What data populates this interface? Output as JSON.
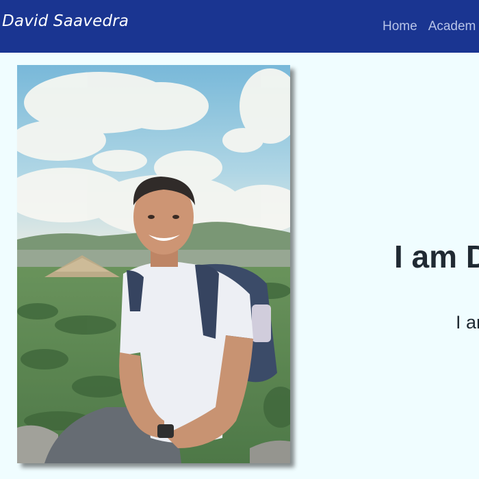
{
  "navbar": {
    "brand": "David Saavedra",
    "links": [
      "Home",
      "Academ"
    ]
  },
  "hero": {
    "heading": "I am D",
    "subtext": "I ar"
  },
  "colors": {
    "navbar_bg": "#1a3591",
    "page_bg": "#f0fdff",
    "heading_text": "#202a33"
  }
}
